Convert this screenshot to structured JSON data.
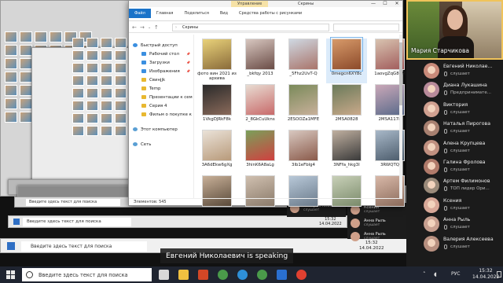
{
  "explorer": {
    "context_tab": "Управление",
    "title": "Скрины",
    "ribbon_tabs": [
      "Файл",
      "Главная",
      "Поделиться",
      "Вид",
      "Средства работы с рисунками"
    ],
    "address": "Скрины",
    "minimize": "—",
    "maximize": "☐",
    "close": "✕",
    "nav_items": [
      {
        "label": "Быстрый доступ",
        "icon": "star-icon",
        "level": "top",
        "pinned": false,
        "selected": false
      },
      {
        "label": "Рабочий стол",
        "icon": "desktop-folder-icon",
        "level": "sub",
        "pinned": true,
        "selected": false
      },
      {
        "label": "Загрузки",
        "icon": "downloads-folder-icon",
        "level": "sub",
        "pinned": true,
        "selected": false
      },
      {
        "label": "Изображения",
        "icon": "pictures-folder-icon",
        "level": "sub",
        "pinned": true,
        "selected": false
      },
      {
        "label": "Свинjjk",
        "icon": "folder-icon",
        "level": "sub",
        "pinned": false,
        "selected": false
      },
      {
        "label": "Temp",
        "icon": "folder-icon",
        "level": "sub",
        "pinned": false,
        "selected": false
      },
      {
        "label": "Презентации к сем",
        "icon": "folder-icon",
        "level": "sub",
        "pinned": false,
        "selected": false
      },
      {
        "label": "Серия 4",
        "icon": "folder-icon",
        "level": "sub",
        "pinned": false,
        "selected": false
      },
      {
        "label": "Фильм о покупке к",
        "icon": "folder-icon",
        "level": "sub",
        "pinned": false,
        "selected": false
      },
      {
        "label": "",
        "icon": "",
        "level": "spacer",
        "pinned": false,
        "selected": false
      },
      {
        "label": "Этот компьютер",
        "icon": "computer-icon",
        "level": "top",
        "pinned": false,
        "selected": false
      },
      {
        "label": "",
        "icon": "",
        "level": "spacer",
        "pinned": false,
        "selected": false
      },
      {
        "label": "Сеть",
        "icon": "network-icon",
        "level": "top",
        "pinned": false,
        "selected": false
      }
    ],
    "files": [
      {
        "name": "фото вин 2021 из архива",
        "selected": false
      },
      {
        "name": "_bkfqy 2013",
        "selected": false
      },
      {
        "name": "_5Fhz2UvT-Q",
        "selected": false
      },
      {
        "name": "0megcn6XY8c",
        "selected": true
      },
      {
        "name": "1aovgZqG8qM",
        "selected": false
      },
      {
        "name": "1VkgDJRkF8k",
        "selected": false
      },
      {
        "name": "2_8GkCuUkns",
        "selected": false
      },
      {
        "name": "2ESOOZa1MFE",
        "selected": false
      },
      {
        "name": "2MSA0828",
        "selected": false
      },
      {
        "name": "2MSA1178",
        "selected": false
      },
      {
        "name": "3A6dEkw6gXg",
        "selected": false
      },
      {
        "name": "3hinK6A8aLg",
        "selected": false
      },
      {
        "name": "3lb1eFblg4",
        "selected": false
      },
      {
        "name": "3NFfa_hkg3I",
        "selected": false
      },
      {
        "name": "3RWQTQ",
        "selected": false
      },
      {
        "name": "",
        "selected": false
      },
      {
        "name": "",
        "selected": false
      },
      {
        "name": "",
        "selected": false
      },
      {
        "name": "",
        "selected": false
      },
      {
        "name": "",
        "selected": false
      }
    ],
    "status": "Элементов: 545"
  },
  "meeting": {
    "speaker_name": "Мария Старчикова",
    "participants": [
      {
        "name": "Евгений Николае...",
        "status": "слушает"
      },
      {
        "name": "Диана Лукашина",
        "status": "Предпринимате..."
      },
      {
        "name": "Виктория",
        "status": "слушает"
      },
      {
        "name": "Наталья Пирогова",
        "status": "слушает"
      },
      {
        "name": "Алена Крупцева",
        "status": "слушает"
      },
      {
        "name": "Галина Фролова",
        "status": "слушает"
      },
      {
        "name": "Артем Филимонов",
        "status": "ТОП лидер Ори..."
      },
      {
        "name": "Ксения",
        "status": "слушает"
      },
      {
        "name": "Анна Рыль",
        "status": "слушает"
      },
      {
        "name": "Валерия Алексеева",
        "status": "слушает"
      }
    ],
    "mini_list_a": [
      {
        "name": "Валерия Алексеева",
        "status": "слушает"
      },
      {
        "name": "Ксения",
        "status": "слушает"
      }
    ],
    "mini_list_b": [
      {
        "name": "Анна Рыль",
        "status": "слушает"
      },
      {
        "name": "Анна Рыль",
        "status": "слушает"
      },
      {
        "name": "Валерия Алексеева",
        "status": "слушает"
      }
    ],
    "caption_name": "Евгений Николаевич",
    "caption_suffix": " is speaking"
  },
  "taskbar": {
    "search_placeholder": "Введите здесь текст для поиска",
    "mirror_search_1": "Введите здесь текст для поиска",
    "mirror_search_2": "Введите здесь текст для поиска",
    "mirror_search_3": "Введите здесь текст для поиска",
    "apps": [
      "task-view-icon",
      "explorer-icon",
      "powerpoint-icon",
      "chrome-icon",
      "edge-icon",
      "chrome-icon",
      "meeting-app-icon",
      "yandex-icon"
    ],
    "lang": "РУС",
    "time": "15:32",
    "date": "14.04.2022",
    "mirror_time": "15:32",
    "mirror_date": "14.04.2022",
    "mirror_time_2": "15:32",
    "mirror_date_2": "14.04.2022"
  },
  "colors": {
    "accent": "#1a73c9",
    "speaker_border": "#f0c35a",
    "taskbar": "#1f2430"
  }
}
